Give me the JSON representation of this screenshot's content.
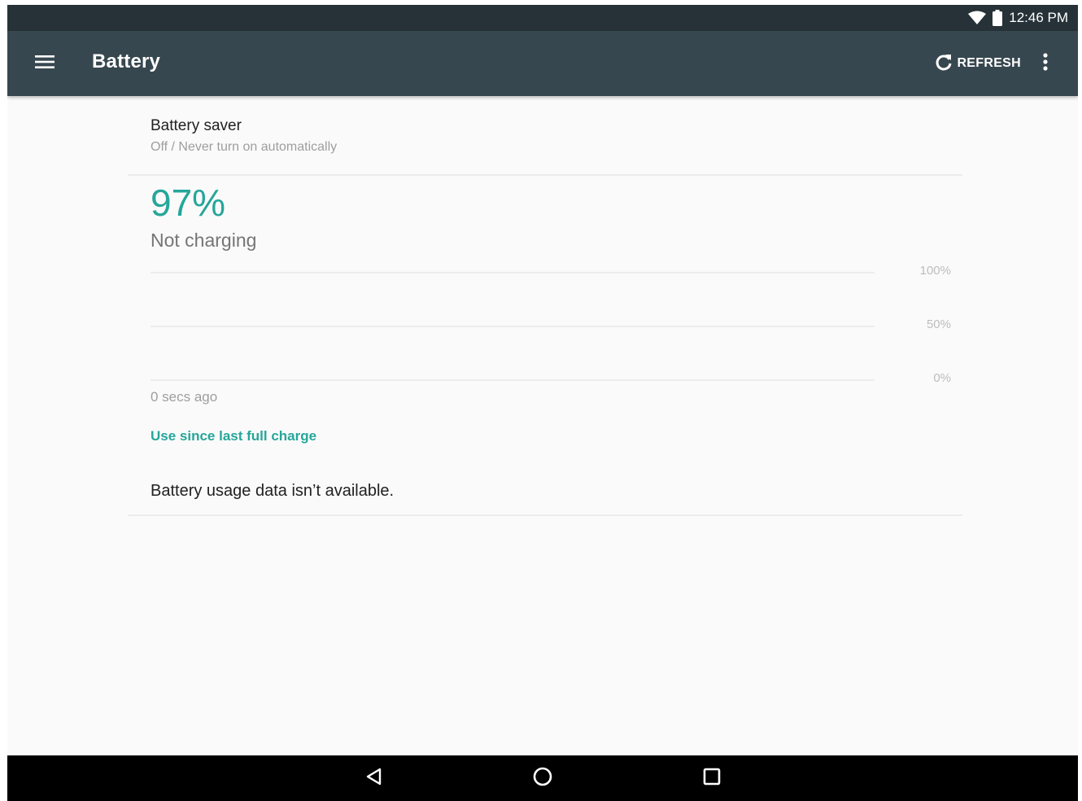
{
  "status_bar": {
    "time": "12:46 PM"
  },
  "app_bar": {
    "title": "Battery",
    "refresh_label": "REFRESH"
  },
  "battery_saver": {
    "title": "Battery saver",
    "summary": "Off / Never turn on automatically"
  },
  "battery": {
    "percentage": "97%",
    "status": "Not charging"
  },
  "graph": {
    "labels": [
      "100%",
      "50%",
      "0%"
    ],
    "time_label": "0 secs ago"
  },
  "usage": {
    "link_label": "Use since last full charge",
    "message": "Battery usage data isn’t available."
  },
  "colors": {
    "accent": "#26a69a",
    "app_bar": "#37474f",
    "status_bar": "#263238"
  }
}
